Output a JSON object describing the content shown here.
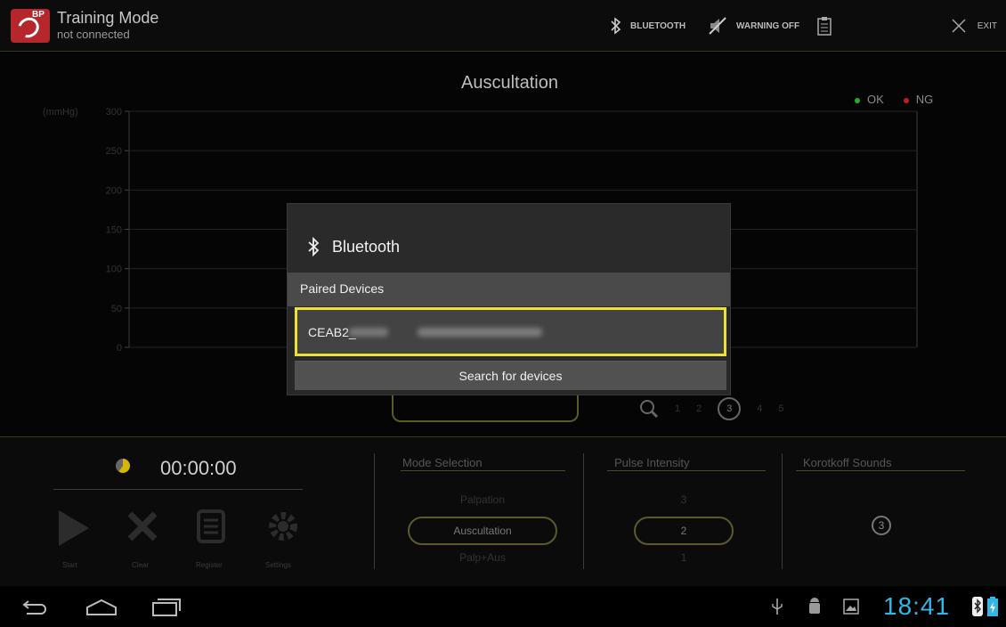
{
  "app": {
    "title": "Training Mode",
    "status": "not connected",
    "badge": "BP"
  },
  "toolbar": {
    "bluetooth_label": "BLUETOOTH",
    "warning_label": "WARNING OFF",
    "exit_label": "EXIT"
  },
  "chart": {
    "title": "Auscultation",
    "legend_ok": "OK",
    "legend_ng": "NG",
    "ok_color": "#2ea82e",
    "ng_color": "#c02020"
  },
  "chart_data": {
    "type": "line",
    "title": "Auscultation",
    "ylabel": "(mmHg)",
    "yticks": [
      300,
      250,
      200,
      150,
      100,
      50,
      0
    ],
    "ylim": [
      0,
      300
    ],
    "series": [
      {
        "name": "OK",
        "color": "#2ea82e",
        "values": []
      },
      {
        "name": "NG",
        "color": "#c02020",
        "values": []
      }
    ],
    "grid": true,
    "legend": "top-right"
  },
  "pager": {
    "items": [
      "1",
      "2",
      "3",
      "4",
      "5"
    ],
    "selected": "3"
  },
  "bottom": {
    "timer": "00:00:00",
    "controls": [
      "Start",
      "Clear",
      "Register",
      "Settings"
    ],
    "mode_title": "Mode Selection",
    "mode_options": [
      "Palpation",
      "Auscultation",
      "Palp+Aus"
    ],
    "mode_selected": "Auscultation",
    "pulse_title": "Pulse Intensity",
    "pulse_options": [
      "3",
      "2",
      "1"
    ],
    "pulse_selected": "2",
    "korotkoff_title": "Korotkoff Sounds",
    "korotkoff_selected": "3"
  },
  "dialog": {
    "title": "Bluetooth",
    "section": "Paired Devices",
    "device_name": "CEAB2_",
    "search_label": "Search for devices"
  },
  "statusbar": {
    "clock": "18:41"
  }
}
